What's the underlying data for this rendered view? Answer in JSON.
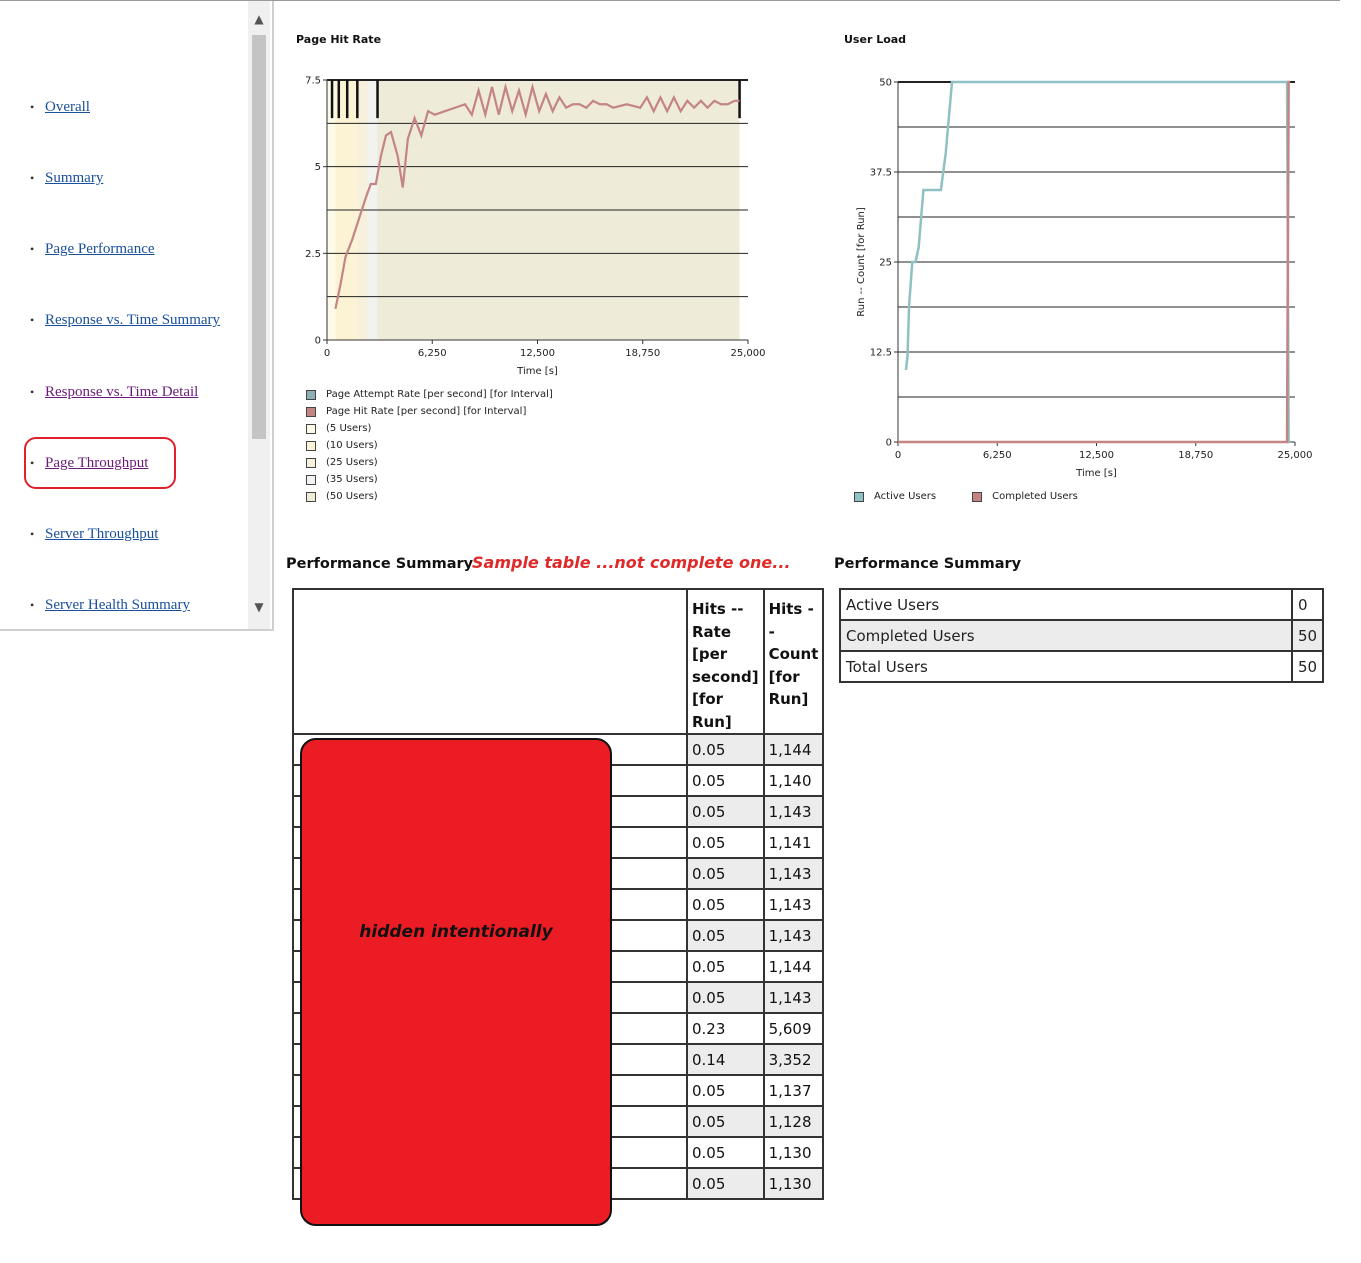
{
  "sidebar": {
    "items": [
      {
        "label": "Overall",
        "visited": false
      },
      {
        "label": "Summary",
        "visited": false
      },
      {
        "label": "Page Performance",
        "visited": false
      },
      {
        "label": "Response vs. Time Summary",
        "visited": false
      },
      {
        "label": "Response vs. Time Detail",
        "visited": true
      },
      {
        "label": "Page Throughput",
        "visited": true,
        "highlighted": true
      },
      {
        "label": "Server Throughput",
        "visited": false
      },
      {
        "label": "Server Health Summary",
        "visited": false
      }
    ],
    "scroll_up_icon": "▲",
    "scroll_down_icon": "▼"
  },
  "chart_data": [
    {
      "type": "line",
      "title": "Page Hit Rate",
      "xlabel": "Time [s]",
      "ylabel": "",
      "xlim": [
        0,
        25000
      ],
      "ylim": [
        0,
        7.5
      ],
      "x_ticks": [
        "0",
        "6,250",
        "12,500",
        "18,750",
        "25,000"
      ],
      "y_ticks": [
        "0",
        "2.5",
        "5",
        "7.5"
      ],
      "grid": true,
      "legend": [
        {
          "label": "Page Attempt Rate [per second] [for Interval]",
          "color": "#8fb0b3"
        },
        {
          "label": "Page Hit Rate [per second] [for Interval]",
          "color": "#c48484"
        },
        {
          "label": "(5 Users)",
          "color": "#fdfbe8"
        },
        {
          "label": "(10 Users)",
          "color": "#fbf3d4"
        },
        {
          "label": "(25 Users)",
          "color": "#f6f0dc"
        },
        {
          "label": "(35 Users)",
          "color": "#f2f2ee"
        },
        {
          "label": "(50 Users)",
          "color": "#efebd9"
        }
      ],
      "bands": [
        {
          "label": "(5 Users)",
          "from": 0,
          "to": 500,
          "color": "#fdfbe8"
        },
        {
          "label": "(10 Users)",
          "from": 500,
          "to": 1800,
          "color": "#fbf3d4"
        },
        {
          "label": "(25 Users)",
          "from": 1800,
          "to": 2400,
          "color": "#f6f0dc"
        },
        {
          "label": "(35 Users)",
          "from": 2400,
          "to": 3000,
          "color": "#f2f2ee"
        },
        {
          "label": "(50 Users)",
          "from": 3000,
          "to": 24500,
          "color": "#efebd9"
        }
      ],
      "markers_x": [
        300,
        700,
        1200,
        1800,
        3000,
        24500
      ],
      "series": [
        {
          "name": "Page Hit Rate [per second] [for Interval]",
          "color": "#c48484",
          "x": [
            500,
            800,
            1100,
            1500,
            1900,
            2300,
            2600,
            2900,
            3200,
            3500,
            3800,
            4200,
            4500,
            4800,
            5200,
            5600,
            6000,
            6400,
            7000,
            7600,
            8200,
            8600,
            9000,
            9400,
            9800,
            10200,
            10600,
            11000,
            11400,
            11800,
            12200,
            12600,
            13000,
            13400,
            13800,
            14200,
            14600,
            15000,
            15400,
            15800,
            16200,
            16600,
            17000,
            17800,
            18600,
            19000,
            19400,
            19800,
            20200,
            20600,
            21000,
            21400,
            21800,
            22200,
            22600,
            23000,
            23400,
            23800,
            24200,
            24500
          ],
          "y": [
            0.9,
            1.6,
            2.4,
            2.9,
            3.5,
            4.1,
            4.5,
            4.5,
            5.3,
            5.9,
            6.0,
            5.3,
            4.4,
            5.8,
            6.4,
            5.9,
            6.6,
            6.5,
            6.6,
            6.7,
            6.8,
            6.5,
            7.2,
            6.5,
            7.3,
            6.5,
            7.3,
            6.6,
            7.2,
            6.5,
            7.3,
            6.6,
            7.1,
            6.6,
            7.0,
            6.7,
            6.8,
            6.8,
            6.7,
            6.9,
            6.8,
            6.8,
            6.7,
            6.8,
            6.7,
            7.0,
            6.6,
            7.0,
            6.6,
            7.0,
            6.6,
            6.9,
            6.7,
            6.9,
            6.7,
            6.9,
            6.8,
            6.8,
            6.9,
            6.9
          ]
        }
      ]
    },
    {
      "type": "line",
      "title": "User Load",
      "xlabel": "Time [s]",
      "ylabel": "Run -- Count [for Run]",
      "xlim": [
        0,
        25000
      ],
      "ylim": [
        0,
        50
      ],
      "x_ticks": [
        "0",
        "6,250",
        "12,500",
        "18,750",
        "25,000"
      ],
      "y_ticks": [
        "0",
        "12.5",
        "25",
        "37.5",
        "50"
      ],
      "grid": true,
      "legend": [
        {
          "label": "Active Users",
          "color": "#8fc0c2"
        },
        {
          "label": "Completed Users",
          "color": "#c48484"
        }
      ],
      "series": [
        {
          "name": "Active Users",
          "color": "#8fc0c2",
          "x": [
            500,
            600,
            700,
            900,
            1100,
            1300,
            1600,
            1800,
            2700,
            3000,
            3400,
            24500,
            24600,
            24700
          ],
          "y": [
            10,
            12,
            19,
            25,
            25,
            27,
            35,
            35,
            35,
            40,
            50,
            50,
            0,
            0
          ]
        },
        {
          "name": "Completed Users",
          "color": "#c48484",
          "x": [
            0,
            24500,
            24600,
            24700
          ],
          "y": [
            0,
            0,
            50,
            50
          ]
        }
      ]
    }
  ],
  "performance_summary_left": {
    "title": "Performance Summary",
    "note": "Sample table ...not complete one...",
    "hidden_label": "hidden intentionally",
    "columns": [
      "",
      "Hits -- Rate [per second] [for Run]",
      "Hits -- Count [for Run]"
    ],
    "rows": [
      {
        "rate": "0.05",
        "count": "1,144"
      },
      {
        "rate": "0.05",
        "count": "1,140"
      },
      {
        "rate": "0.05",
        "count": "1,143"
      },
      {
        "rate": "0.05",
        "count": "1,141"
      },
      {
        "rate": "0.05",
        "count": "1,143"
      },
      {
        "rate": "0.05",
        "count": "1,143"
      },
      {
        "rate": "0.05",
        "count": "1,143"
      },
      {
        "rate": "0.05",
        "count": "1,144"
      },
      {
        "rate": "0.05",
        "count": "1,143"
      },
      {
        "rate": "0.23",
        "count": "5,609"
      },
      {
        "rate": "0.14",
        "count": "3,352"
      },
      {
        "rate": "0.05",
        "count": "1,137"
      },
      {
        "rate": "0.05",
        "count": "1,128"
      },
      {
        "rate": "0.05",
        "count": "1,130"
      },
      {
        "rate": "0.05",
        "count": "1,130"
      }
    ]
  },
  "performance_summary_right": {
    "title": "Performance Summary",
    "rows": [
      {
        "label": "Active Users",
        "value": "0"
      },
      {
        "label": "Completed Users",
        "value": "50"
      },
      {
        "label": "Total Users",
        "value": "50"
      }
    ]
  }
}
